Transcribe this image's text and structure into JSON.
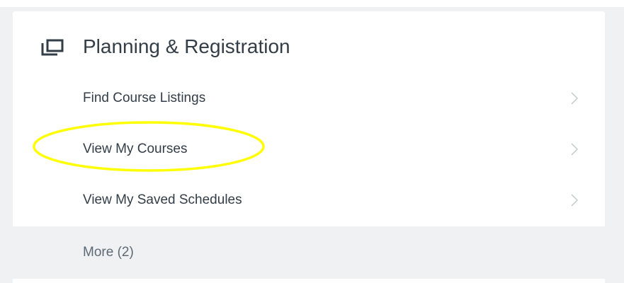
{
  "card": {
    "title": "Planning & Registration",
    "icon": "window-stack-icon",
    "tasks": [
      {
        "label": "Find Course Listings",
        "icon": "chevron-right-icon"
      },
      {
        "label": "View My Courses",
        "icon": "chevron-right-icon"
      },
      {
        "label": "View My Saved Schedules",
        "icon": "chevron-right-icon"
      }
    ],
    "more_label": "More (2)"
  },
  "colors": {
    "text": "#333d47",
    "muted_text": "#5e6a75",
    "chevron": "#c4c9ce",
    "more_background": "#f0f1f2",
    "highlight": "#ffff00"
  }
}
